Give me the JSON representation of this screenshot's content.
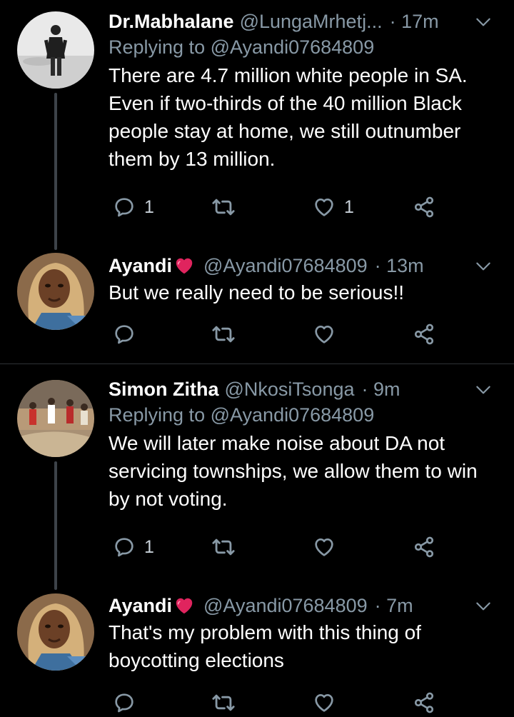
{
  "colors": {
    "background": "#000000",
    "text": "#ffffff",
    "muted": "#8899a6",
    "separator": "#2f3336",
    "thread_line": "#3d4349",
    "heart_emoji": "#e0245e"
  },
  "icons": {
    "reply": "speech-bubble-icon",
    "retweet": "retweet-icon",
    "like": "heart-outline-icon",
    "share": "share-icon",
    "more": "chevron-down-icon",
    "name_emoji": "red-heart-emoji"
  },
  "tweets": [
    {
      "name": "Dr.Mabhalane",
      "handle": "@LungaMrhetj...",
      "time": "· 17m",
      "replying_prefix": "Replying to",
      "replying_handle": "@Ayandi07684809",
      "text": "There are 4.7 million white people in SA. Even if two-thirds of the 40 million Black people stay at home, we still outnumber them by 13 million.",
      "reply_count": "1",
      "retweet_count": "",
      "like_count": "1"
    },
    {
      "name": "Ayandi",
      "handle": "@Ayandi07684809",
      "time": "· 13m",
      "text": "But we really need to be serious!!",
      "reply_count": "",
      "retweet_count": "",
      "like_count": ""
    },
    {
      "name": "Simon Zitha",
      "handle": "@NkosiTsonga",
      "time": "· 9m",
      "replying_prefix": "Replying to",
      "replying_handle": "@Ayandi07684809",
      "text": "We will later make noise about DA not servicing townships, we allow them to win by not voting.",
      "reply_count": "1",
      "retweet_count": "",
      "like_count": ""
    },
    {
      "name": "Ayandi",
      "handle": "@Ayandi07684809",
      "time": "· 7m",
      "text": "That's my problem with this thing of boycotting elections",
      "reply_count": "",
      "retweet_count": "",
      "like_count": ""
    }
  ]
}
